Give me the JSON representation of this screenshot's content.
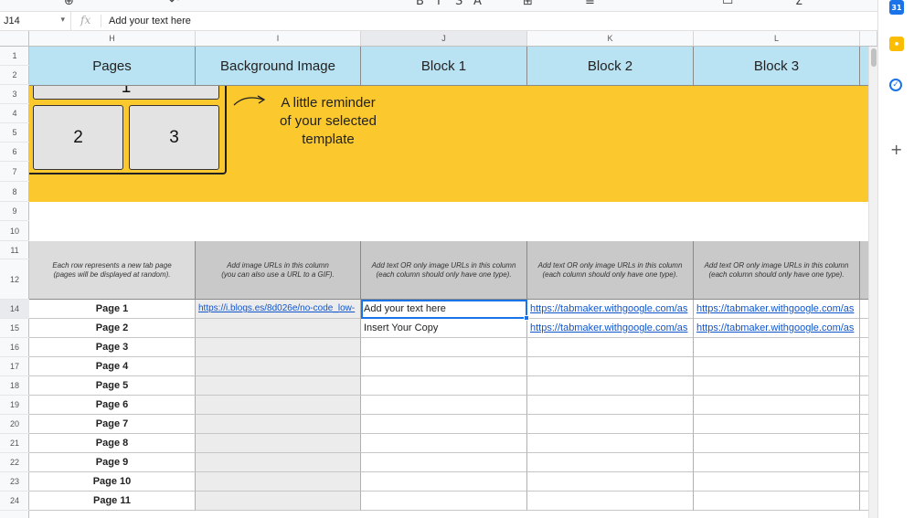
{
  "formula_bar": {
    "cell_ref": "J14",
    "fx_label": "fx",
    "content": "Add your text here"
  },
  "columns": [
    "H",
    "I",
    "J",
    "K",
    "L"
  ],
  "rows": [
    "1",
    "2",
    "3",
    "4",
    "5",
    "6",
    "7",
    "8",
    "9",
    "10",
    "11",
    "12",
    "14",
    "15",
    "16",
    "17",
    "18",
    "19",
    "20",
    "21",
    "22",
    "23",
    "24"
  ],
  "template_preview": {
    "box1": "1",
    "box2": "2",
    "box3": "3"
  },
  "reminder": {
    "line1": "A little reminder",
    "line2": "of your selected",
    "line3": "template"
  },
  "table": {
    "headers": [
      "Pages",
      "Background Image",
      "Block 1",
      "Block 2",
      "Block 3"
    ],
    "descriptions": {
      "pages": [
        "Each row represents a new tab page",
        "(pages will be displayed at random)."
      ],
      "background": [
        "Add image URLs in this column",
        "(you can also use a URL to a GIF)."
      ],
      "block": [
        "Add text OR only image URLs in this column",
        "(each column should only have one type)."
      ]
    },
    "pages": [
      "Page 1",
      "Page 2",
      "Page 3",
      "Page 4",
      "Page 5",
      "Page 6",
      "Page 7",
      "Page 8",
      "Page 9",
      "Page 10",
      "Page 11"
    ],
    "bg_image_row1": "https://i.blogs.es/8d026e/no-code_low-",
    "block1_row1": "Add your text here",
    "block1_row2": "Insert Your Copy",
    "block2_row1": "https://tabmaker.withgoogle.com/as",
    "block2_row2": "https://tabmaker.withgoogle.com/as",
    "block3_row1": "https://tabmaker.withgoogle.com/as",
    "block3_row2": "https://tabmaker.withgoogle.com/as"
  },
  "side_panel": {
    "plus": "+"
  },
  "colors": {
    "banner": "#fbc82d",
    "header": "#b9e2f2",
    "selection": "#1a73e8",
    "link": "#1155cc"
  }
}
